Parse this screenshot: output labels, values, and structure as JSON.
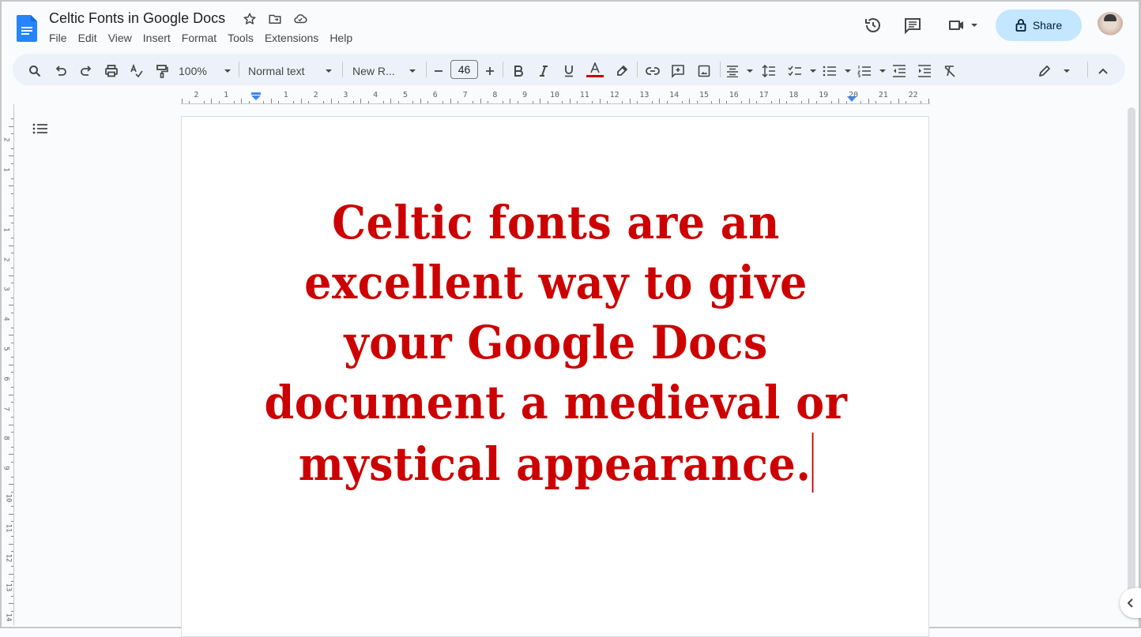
{
  "document": {
    "title": "Celtic Fonts in Google Docs",
    "body_text": "Celtic fonts are an excellent way to give your Google Docs document a medieval or mystical appearance.",
    "text_color": "#cc0000"
  },
  "menu": {
    "items": [
      "File",
      "Edit",
      "View",
      "Insert",
      "Format",
      "Tools",
      "Extensions",
      "Help"
    ]
  },
  "header": {
    "share_label": "Share",
    "icons": [
      "star-icon",
      "move-to-folder-icon",
      "cloud-saved-icon",
      "version-history-icon",
      "comments-icon",
      "meet-icon",
      "lock-icon"
    ]
  },
  "toolbar": {
    "zoom": "100%",
    "style": "Normal text",
    "font": "New R...",
    "font_size": "46",
    "text_color_swatch": "#cc0000",
    "accent": "#c2e7ff"
  },
  "ruler": {
    "horizontal_labels": [
      "2",
      "1",
      "1",
      "2",
      "3",
      "4",
      "5",
      "6",
      "7",
      "8",
      "9",
      "10",
      "11",
      "12",
      "13",
      "14",
      "15",
      "16",
      "17",
      "18",
      "19",
      "20",
      "21",
      "22"
    ],
    "vertical_labels": [
      "2",
      "1",
      "1",
      "2",
      "3",
      "4",
      "5",
      "6",
      "7",
      "8",
      "9",
      "10",
      "11",
      "12",
      "13",
      "14"
    ]
  }
}
